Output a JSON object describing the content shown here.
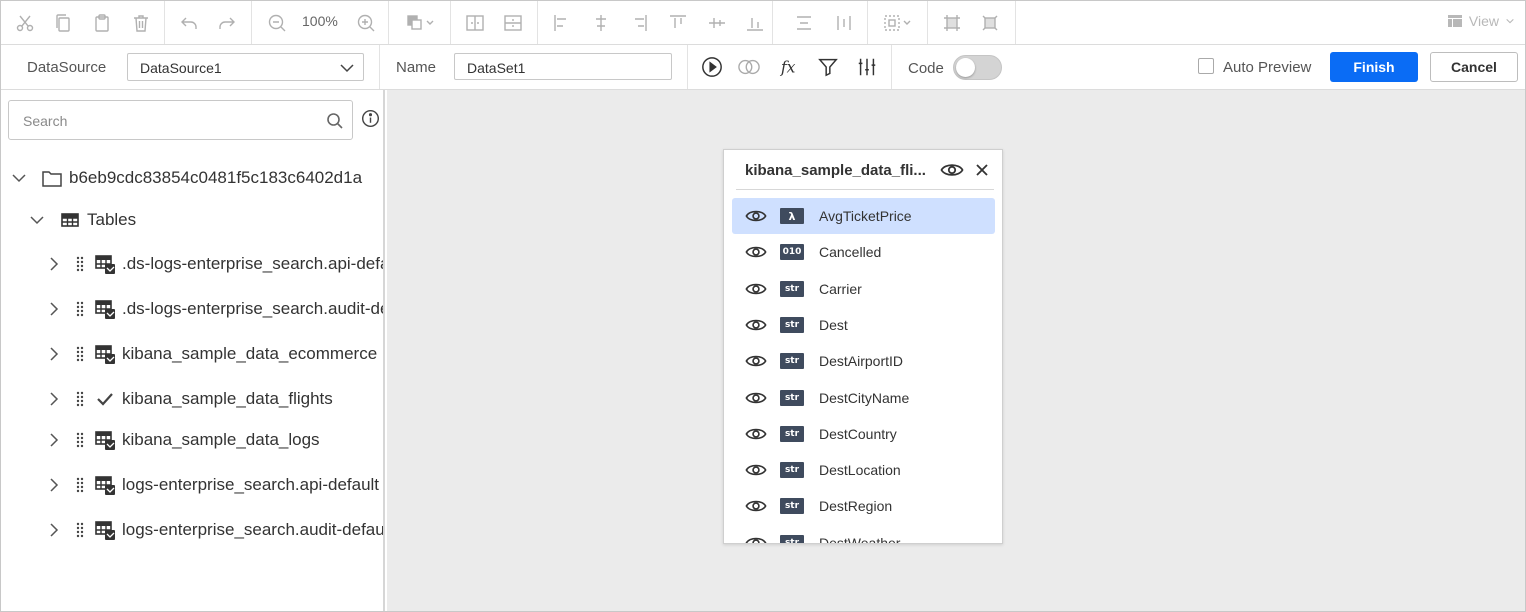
{
  "toolbar": {
    "zoom_label": "100%",
    "view_label": "View"
  },
  "querybar": {
    "datasource_label": "DataSource",
    "datasource_value": "DataSource1",
    "name_label": "Name",
    "name_value": "DataSet1",
    "code_label": "Code",
    "code_toggle_on": false,
    "auto_preview_label": "Auto Preview",
    "auto_preview_checked": false,
    "finish_label": "Finish",
    "cancel_label": "Cancel"
  },
  "explorer": {
    "search_placeholder": "Search",
    "root_label": "b6eb9cdc83854c0481f5c183c6402d1a",
    "tables_label": "Tables",
    "tables": [
      {
        "label": ".ds-logs-enterprise_search.api-default",
        "selected": false
      },
      {
        "label": ".ds-logs-enterprise_search.audit-default",
        "selected": false
      },
      {
        "label": "kibana_sample_data_ecommerce",
        "selected": false
      },
      {
        "label": "kibana_sample_data_flights",
        "selected": true
      },
      {
        "label": "kibana_sample_data_logs",
        "selected": false
      },
      {
        "label": "logs-enterprise_search.api-default",
        "selected": false
      },
      {
        "label": "logs-enterprise_search.audit-default",
        "selected": false
      }
    ]
  },
  "card": {
    "title": "kibana_sample_data_fli...",
    "fields": [
      {
        "name": "AvgTicketPrice",
        "type": "λ",
        "selected": true
      },
      {
        "name": "Cancelled",
        "type": "010",
        "selected": false
      },
      {
        "name": "Carrier",
        "type": "str",
        "selected": false
      },
      {
        "name": "Dest",
        "type": "str",
        "selected": false
      },
      {
        "name": "DestAirportID",
        "type": "str",
        "selected": false
      },
      {
        "name": "DestCityName",
        "type": "str",
        "selected": false
      },
      {
        "name": "DestCountry",
        "type": "str",
        "selected": false
      },
      {
        "name": "DestLocation",
        "type": "str",
        "selected": false
      },
      {
        "name": "DestRegion",
        "type": "str",
        "selected": false
      },
      {
        "name": "DestWeather",
        "type": "str",
        "selected": false
      }
    ]
  },
  "colors": {
    "accent": "#0a6cf5",
    "selection": "#cfe0ff",
    "canvas": "#ebebeb",
    "badge": "#3f4b5e"
  }
}
